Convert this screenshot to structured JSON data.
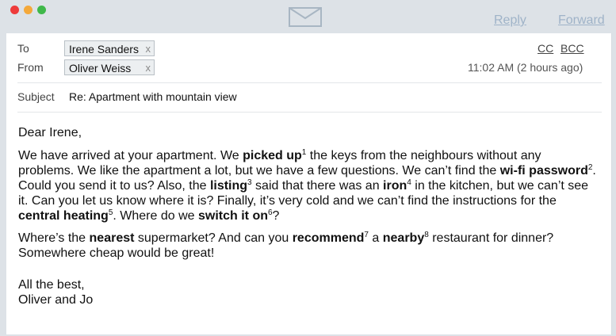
{
  "window": {
    "reply_label": "Reply",
    "forward_label": "Forward"
  },
  "header": {
    "to_label": "To",
    "from_label": "From",
    "to": "Irene Sanders",
    "from": "Oliver Weiss",
    "remove_glyph": "x",
    "cc_label": "CC",
    "bcc_label": "BCC",
    "time": "11:02 AM (2 hours ago)",
    "subject_label": "Subject",
    "subject": "Re: Apartment with mountain view"
  },
  "body": {
    "greeting": "Dear Irene,",
    "p1": {
      "t1": "We have arrived at your apartment. We ",
      "b1": "picked up",
      "s1": "1",
      "t2": " the keys from the neighbours without any problems. We like the apartment a lot, but we have a few questions. We can’t find the ",
      "b2": "wi-fi password",
      "s2": "2",
      "t3": ". Could you send it to us? Also, the ",
      "b3": "listing",
      "s3": "3",
      "t4": " said that there was an ",
      "b4": "iron",
      "s4": "4",
      "t5": " in the kitchen, but we can’t see it. Can you let us know where it is? Finally, it’s very cold and we can’t find the instructions for the ",
      "b5": "central heating",
      "s5": "5",
      "t6": ". Where do we ",
      "b6": "switch it on",
      "s6": "6",
      "t7": "?"
    },
    "p2": {
      "t1": "Where’s the ",
      "b1": "nearest",
      "t2": " supermarket? And can you ",
      "b2": "recommend",
      "s2": "7",
      "t3": " a ",
      "b3": "nearby",
      "s3": "8",
      "t4": " restaurant for dinner? Somewhere cheap would be great!"
    },
    "signoff": "All the best,",
    "signature": "Oliver and Jo"
  },
  "colors": {
    "close": "#ee3b3b",
    "minimize": "#f4a93b",
    "maximize": "#3fb84a",
    "link": "#9fb3c8",
    "chrome": "#dde2e7"
  },
  "icons": [
    "close-dot-icon",
    "minimize-dot-icon",
    "maximize-dot-icon",
    "envelope-icon",
    "remove-recipient-icon"
  ]
}
